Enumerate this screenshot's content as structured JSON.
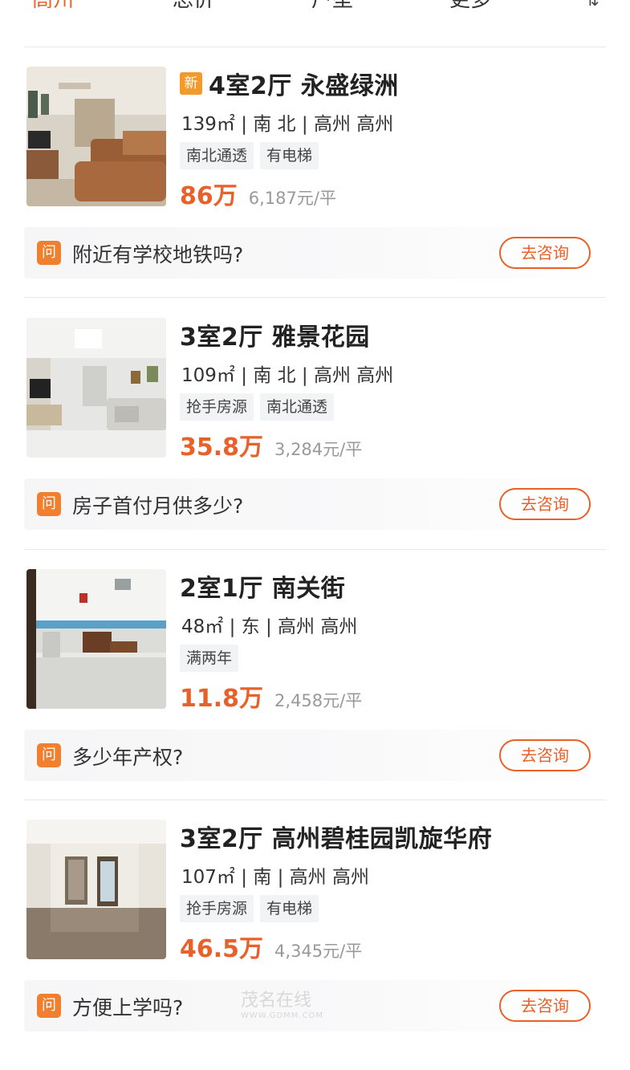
{
  "filter_bar": {
    "items": [
      "高州",
      "总价",
      "户型",
      "更多"
    ],
    "active_index": 0,
    "extra_icon": "sort-icon"
  },
  "listings": [
    {
      "badge": "新",
      "title": "4室2厅 永盛绿洲",
      "meta": "139㎡ | 南 北 | 高州 高州",
      "tags": [
        "南北通透",
        "有电梯"
      ],
      "price": "86万",
      "unit_price": "6,187元/平",
      "question": "附近有学校地铁吗?",
      "consult_label": "去咨询",
      "photo": "living-room-photo"
    },
    {
      "badge": "",
      "title": "3室2厅 雅景花园",
      "meta": "109㎡ | 南 北 | 高州 高州",
      "tags": [
        "抢手房源",
        "南北通透"
      ],
      "price": "35.8万",
      "unit_price": "3,284元/平",
      "question": "房子首付月供多少?",
      "consult_label": "去咨询",
      "photo": "living-room-photo"
    },
    {
      "badge": "",
      "title": "2室1厅 南关街",
      "meta": "48㎡ | 东 | 高州 高州",
      "tags": [
        "满两年"
      ],
      "price": "11.8万",
      "unit_price": "2,458元/平",
      "question": "多少年产权?",
      "consult_label": "去咨询",
      "photo": "room-photo"
    },
    {
      "badge": "",
      "title": "3室2厅 高州碧桂园凯旋华府",
      "meta": "107㎡ | 南 | 高州 高州",
      "tags": [
        "抢手房源",
        "有电梯"
      ],
      "price": "46.5万",
      "unit_price": "4,345元/平",
      "question": "方便上学吗?",
      "consult_label": "去咨询",
      "photo": "empty-room-photo"
    }
  ],
  "qa_icon_label": "问",
  "watermark": {
    "main": "茂名在线",
    "sub": "WWW.GDMM.COM"
  },
  "colors": {
    "accent": "#e8612a",
    "badge": "#f39a2c",
    "tag_bg": "#f2f3f5"
  }
}
